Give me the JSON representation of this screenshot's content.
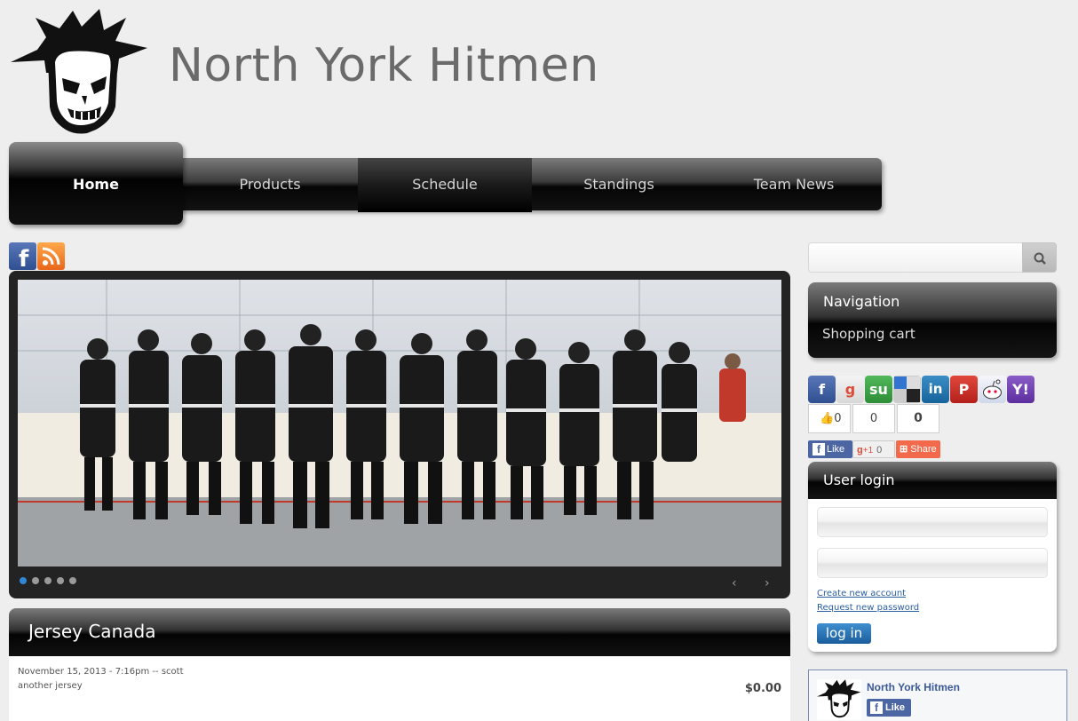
{
  "site": {
    "title": "North York Hitmen"
  },
  "menu": {
    "items": [
      {
        "label": "Home"
      },
      {
        "label": "Products"
      },
      {
        "label": "Schedule"
      },
      {
        "label": "Standings"
      },
      {
        "label": "Team News"
      }
    ],
    "active": "Home"
  },
  "social_top": {
    "icons": [
      "facebook-icon",
      "rss-icon"
    ]
  },
  "slideshow": {
    "slide_count": 5,
    "active_slide": 1
  },
  "article": {
    "title": "Jersey Canada",
    "meta": "November 15, 2013 - 7:16pm -- scott",
    "subtitle": "another jersey",
    "price": "$0.00"
  },
  "search": {
    "placeholder": ""
  },
  "navigation": {
    "title": "Navigation",
    "items": [
      {
        "label": "Shopping cart"
      }
    ]
  },
  "share": {
    "icons": [
      "facebook-icon",
      "google-icon",
      "stumbleupon-icon",
      "delicious-icon",
      "linkedin-icon",
      "pinterest-icon",
      "reddit-icon",
      "yahoo-icon"
    ],
    "counts": {
      "like": "0",
      "plusone": "0",
      "total": "0"
    },
    "like_label": "Like",
    "gplus_label": "+1",
    "gplus_count": "0",
    "share_label": "Share"
  },
  "login": {
    "title": "User login",
    "create_account": "Create new account",
    "request_password": "Request new password",
    "button": "log in"
  },
  "facebook_box": {
    "name": "North York Hitmen",
    "like": "Like"
  },
  "colors": {
    "background": "#eeeeef",
    "link": "#2a5fa0",
    "active_dot": "#2f87d8",
    "facebook": "#3b5998"
  }
}
